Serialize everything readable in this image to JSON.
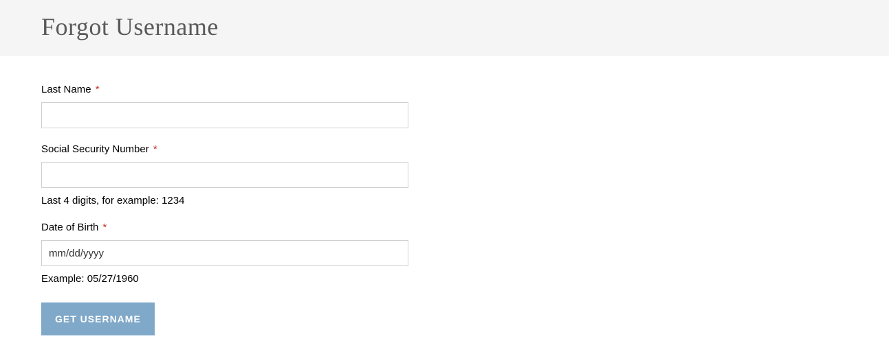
{
  "header": {
    "title": "Forgot Username"
  },
  "form": {
    "last_name": {
      "label": "Last Name",
      "required_mark": "*",
      "value": ""
    },
    "ssn": {
      "label": "Social Security Number",
      "required_mark": "*",
      "value": "",
      "help": "Last 4 digits, for example: 1234"
    },
    "dob": {
      "label": "Date of Birth",
      "required_mark": "*",
      "placeholder": "mm/dd/yyyy",
      "value": "",
      "help": "Example: 05/27/1960"
    },
    "submit_label": "GET USERNAME"
  }
}
